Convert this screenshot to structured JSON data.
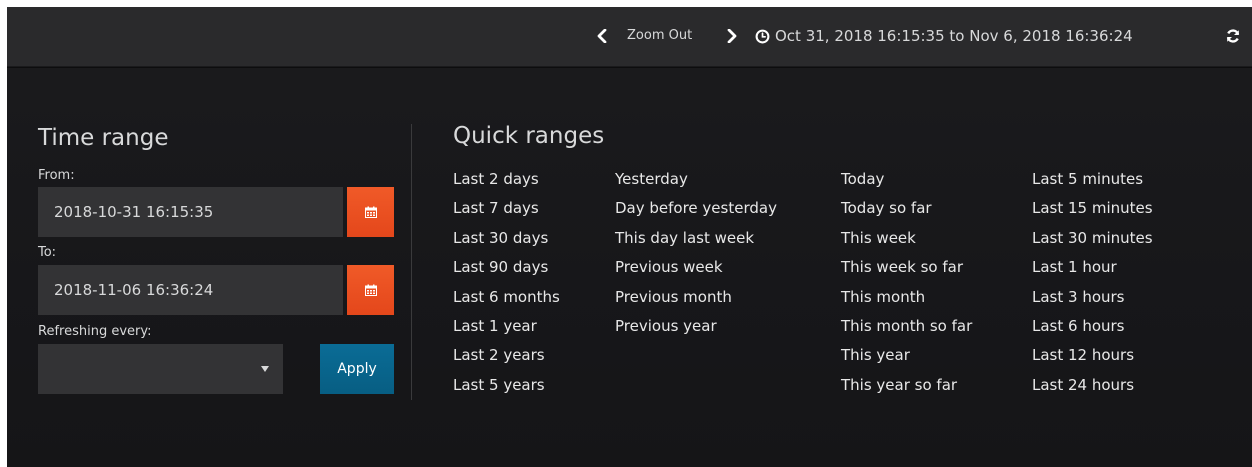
{
  "topbar": {
    "zoom_out_label": "Zoom Out",
    "range_label": "Oct 31, 2018 16:15:35 to Nov 6, 2018 16:36:24",
    "icons": {
      "prev": "chevron-left-icon",
      "next": "chevron-right-icon",
      "clock": "clock-icon",
      "refresh": "refresh-icon"
    }
  },
  "time_range": {
    "title": "Time range",
    "from_label": "From:",
    "from_value": "2018-10-31 16:15:35",
    "to_label": "To:",
    "to_value": "2018-11-06 16:36:24",
    "refresh_label": "Refreshing every:",
    "refresh_value": "",
    "apply_label": "Apply",
    "calendar_icon": "calendar-icon"
  },
  "quick_ranges": {
    "title": "Quick ranges",
    "columns": [
      [
        "Last 2 days",
        "Last 7 days",
        "Last 30 days",
        "Last 90 days",
        "Last 6 months",
        "Last 1 year",
        "Last 2 years",
        "Last 5 years"
      ],
      [
        "Yesterday",
        "Day before yesterday",
        "This day last week",
        "Previous week",
        "Previous month",
        "Previous year"
      ],
      [
        "Today",
        "Today so far",
        "This week",
        "This week so far",
        "This month",
        "This month so far",
        "This year",
        "This year so far"
      ],
      [
        "Last 5 minutes",
        "Last 15 minutes",
        "Last 30 minutes",
        "Last 1 hour",
        "Last 3 hours",
        "Last 6 hours",
        "Last 12 hours",
        "Last 24 hours"
      ]
    ]
  },
  "colors": {
    "background": "#161618",
    "topbar": "#2a2a2c",
    "input_bg": "#333335",
    "accent_orange": "#f05a28",
    "apply_blue": "#0a6c96",
    "text": "#d8d9da"
  }
}
